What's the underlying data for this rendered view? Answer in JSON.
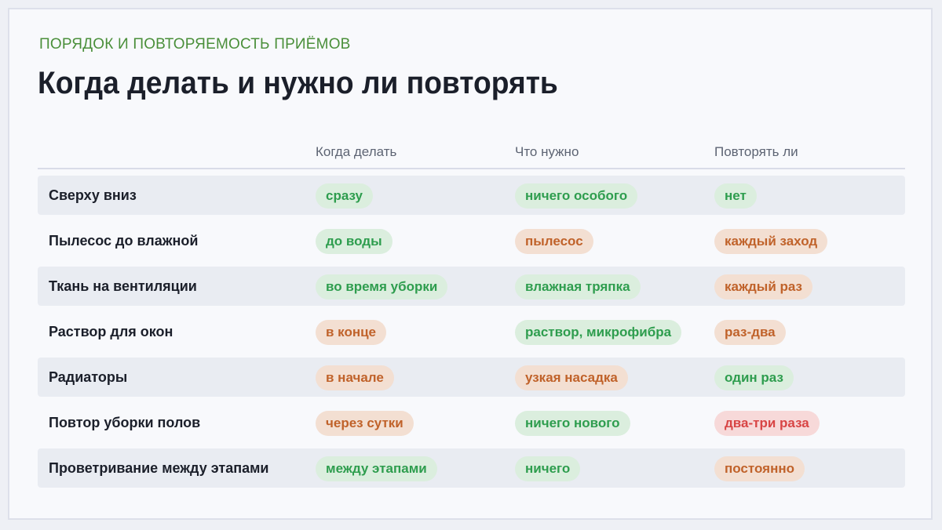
{
  "eyebrow": "ПОРЯДОК И ПОВТОРЯЕМОСТЬ ПРИЁМОВ",
  "title": "Когда делать и нужно ли повторять",
  "colors": {
    "green_text": "#2e9d4e",
    "green_bg": "#dbeede",
    "orange_text": "#c0622a",
    "orange_bg": "#f3dfd2",
    "red_text": "#d84545",
    "red_bg": "#f7d9d9",
    "eyebrow": "#4a8f3a"
  },
  "table": {
    "headers": [
      "",
      "Когда делать",
      "Что нужно",
      "Повторять ли"
    ],
    "rows": [
      {
        "label": "Сверху вниз",
        "cells": [
          {
            "text": "сразу",
            "tone": "green"
          },
          {
            "text": "ничего особого",
            "tone": "green"
          },
          {
            "text": "нет",
            "tone": "green"
          }
        ]
      },
      {
        "label": "Пылесос до влажной",
        "cells": [
          {
            "text": "до воды",
            "tone": "green"
          },
          {
            "text": "пылесос",
            "tone": "orange"
          },
          {
            "text": "каждый заход",
            "tone": "orange"
          }
        ]
      },
      {
        "label": "Ткань на вентиляции",
        "cells": [
          {
            "text": "во время уборки",
            "tone": "green"
          },
          {
            "text": "влажная тряпка",
            "tone": "green"
          },
          {
            "text": "каждый раз",
            "tone": "orange"
          }
        ]
      },
      {
        "label": "Раствор для окон",
        "cells": [
          {
            "text": "в конце",
            "tone": "orange"
          },
          {
            "text": "раствор, микрофибра",
            "tone": "green"
          },
          {
            "text": "раз-два",
            "tone": "orange"
          }
        ]
      },
      {
        "label": "Радиаторы",
        "cells": [
          {
            "text": "в начале",
            "tone": "orange"
          },
          {
            "text": "узкая насадка",
            "tone": "orange"
          },
          {
            "text": "один раз",
            "tone": "green"
          }
        ]
      },
      {
        "label": "Повтор уборки полов",
        "cells": [
          {
            "text": "через сутки",
            "tone": "orange"
          },
          {
            "text": "ничего нового",
            "tone": "green"
          },
          {
            "text": "два-три раза",
            "tone": "red"
          }
        ]
      },
      {
        "label": "Проветривание между этапами",
        "cells": [
          {
            "text": "между этапами",
            "tone": "green"
          },
          {
            "text": "ничего",
            "tone": "green"
          },
          {
            "text": "постоянно",
            "tone": "orange"
          }
        ]
      }
    ]
  }
}
